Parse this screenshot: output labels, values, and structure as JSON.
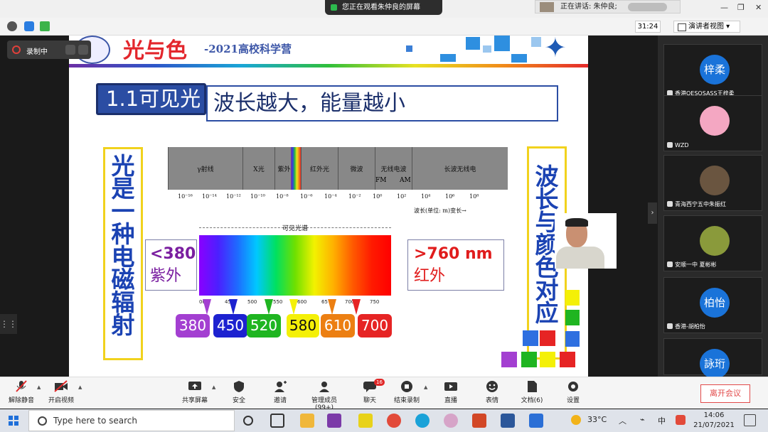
{
  "top": {
    "share_banner": "您正在观看朱仲良的屏幕",
    "speaking": "正在讲话: 朱仲良;",
    "timer": "31:24",
    "view_mode": "演讲者视图"
  },
  "recording": {
    "label": "录制中"
  },
  "slide": {
    "brand": "光与色",
    "brand_sub": "-2021高校科学营",
    "head_tag": "1.1可见光",
    "head_main": "波长越大，能量越小",
    "left_vertical": "光是一种电磁辐射",
    "right_vertical": "波长与颜色对应",
    "spectrum_segments": [
      "γ射线",
      "X光",
      "紫外",
      "红外光",
      "微波",
      "无线电波",
      "长波无线电"
    ],
    "fm": "FM",
    "am": "AM",
    "ticks": [
      "10⁻¹⁶",
      "10⁻¹⁴",
      "10⁻¹²",
      "10⁻¹⁰",
      "10⁻⁸",
      "10⁻⁶",
      "10⁻⁴",
      "10⁻²",
      "10⁰",
      "10²",
      "10⁴",
      "10⁶",
      "10⁸"
    ],
    "wavelength_label": "波长(单位: m)变长→",
    "visible_label": "可见光谱",
    "gradient_ticks": [
      "00",
      "45",
      "500",
      "550",
      "600",
      "65",
      "700",
      "750"
    ],
    "left_info": {
      "line1": "<380",
      "line2": "紫外"
    },
    "right_info": {
      "line1": ">760 nm",
      "line2": "红外"
    },
    "color_boxes": [
      {
        "label": "380",
        "color": "#a33fd1"
      },
      {
        "label": "450",
        "color": "#1d22d0"
      },
      {
        "label": "520",
        "color": "#1fb521"
      },
      {
        "label": "580",
        "color": "#f4f007"
      },
      {
        "label": "610",
        "color": "#ec7f12"
      },
      {
        "label": "700",
        "color": "#e62424"
      }
    ]
  },
  "participants": [
    {
      "avatar": "梓柔",
      "name": "香港QESOSASS王梓柔",
      "color": "#1a73d9"
    },
    {
      "avatar": "",
      "name": "WZD",
      "color": "#f4a7c2"
    },
    {
      "avatar": "",
      "name": "青海西宁五中朱振红",
      "color": "#6a5540"
    },
    {
      "avatar": "",
      "name": "安顺一中 夏彬彬",
      "color": "#8a9a3b"
    },
    {
      "avatar": "柏怡",
      "name": "香港-胡柏怡",
      "color": "#1a73d9"
    },
    {
      "avatar": "詠珩",
      "name": "",
      "color": "#1a73d9"
    }
  ],
  "bottom": {
    "mute": "解除静音",
    "video": "开启视频",
    "share": "共享屏幕",
    "security": "安全",
    "invite": "邀请",
    "members": "管理成员(99+)",
    "chat": "聊天",
    "chat_badge": "16",
    "end_record": "结束录制",
    "live": "直播",
    "reactions": "表情",
    "docs": "文档(6)",
    "settings": "设置",
    "leave": "离开会议"
  },
  "taskbar": {
    "search": "Type here to search",
    "temp": "33°C",
    "lang": "中",
    "time": "14:06",
    "date": "21/07/2021"
  }
}
